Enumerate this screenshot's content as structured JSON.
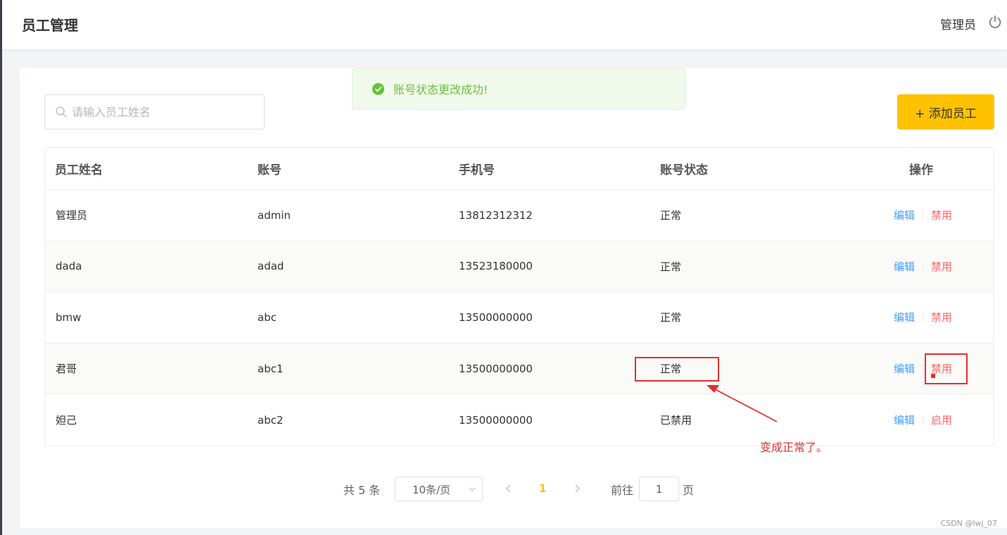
{
  "header": {
    "page_title": "员工管理",
    "user_name": "管理员",
    "logout_icon": "power-icon"
  },
  "toast": {
    "icon": "check-circle-icon",
    "message": "账号状态更改成功!",
    "color": "#67c23a"
  },
  "toolbar": {
    "search_placeholder": "请输入员工姓名",
    "search_value": "",
    "add_button_label": "+ 添加员工",
    "accent": "#ffc200"
  },
  "table": {
    "columns": [
      "员工姓名",
      "账号",
      "手机号",
      "账号状态",
      "操作"
    ],
    "rows": [
      {
        "name": "管理员",
        "account": "admin",
        "phone": "13812312312",
        "status": "正常",
        "edit": "编辑",
        "toggle": "禁用"
      },
      {
        "name": "dada",
        "account": "adad",
        "phone": "13523180000",
        "status": "正常",
        "edit": "编辑",
        "toggle": "禁用"
      },
      {
        "name": "bmw",
        "account": "abc",
        "phone": "13500000000",
        "status": "正常",
        "edit": "编辑",
        "toggle": "禁用"
      },
      {
        "name": "君哥",
        "account": "abc1",
        "phone": "13500000000",
        "status": "正常",
        "edit": "编辑",
        "toggle": "禁用"
      },
      {
        "name": "妲己",
        "account": "abc2",
        "phone": "13500000000",
        "status": "已禁用",
        "edit": "编辑",
        "toggle": "启用"
      }
    ],
    "edit_color": "#419eff",
    "toggle_color": "#fd3333"
  },
  "pagination": {
    "total_text": "共 5 条",
    "page_size": "10条/页",
    "current_page": "1",
    "goto_label": "前往",
    "goto_value": "1",
    "goto_suffix": "页"
  },
  "annotation": {
    "note": "变成正常了。",
    "color": "#e03131"
  },
  "watermark": "CSDN @lwj_07"
}
